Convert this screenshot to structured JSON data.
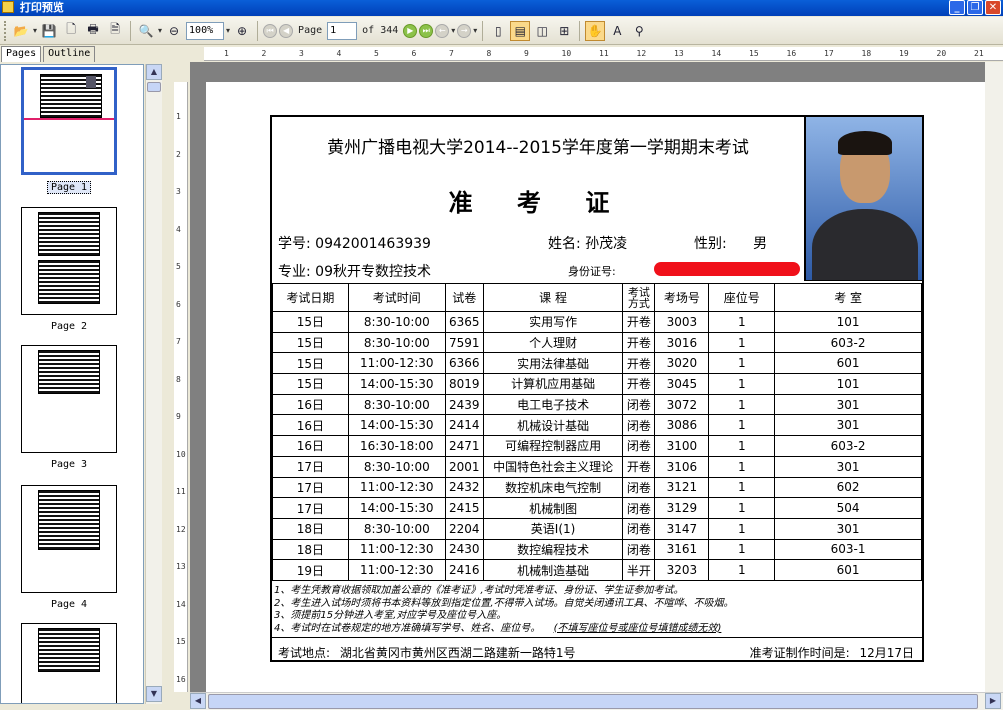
{
  "window": {
    "title": "打印预览"
  },
  "toolbar": {
    "zoom": "100%",
    "page_label": "Page",
    "page_value": "1",
    "of_label": "of 344"
  },
  "left_panel": {
    "tabs": [
      "Pages",
      "Outline"
    ],
    "thumbnails": [
      "Page 1",
      "Page 2",
      "Page 3",
      "Page 4"
    ]
  },
  "ruler": {
    "h_ticks": [
      "1",
      "2",
      "3",
      "4",
      "5",
      "6",
      "7",
      "8",
      "9",
      "10",
      "11",
      "12",
      "13",
      "14",
      "15",
      "16",
      "17",
      "18",
      "19",
      "20",
      "21"
    ],
    "v_ticks": [
      "1",
      "2",
      "3",
      "4",
      "5",
      "6",
      "7",
      "8",
      "9",
      "10",
      "11",
      "12",
      "13",
      "14",
      "15",
      "16"
    ]
  },
  "ticket": {
    "title": "黄州广播电视大学2014--2015学年度第一学期期末考试",
    "heading": "准 考 证",
    "student_id_label": "学号:",
    "student_id": "0942001463939",
    "name_label": "姓名:",
    "name": "孙茂凌",
    "gender_label": "性别:",
    "gender": "男",
    "major_label": "专业:",
    "major": "09秋开专数控技术",
    "id_card_label": "身份证号:",
    "headers": [
      "考试日期",
      "考试时间",
      "试卷",
      "课 程",
      "考试方式",
      "考场号",
      "座位号",
      "考 室"
    ],
    "rows": [
      [
        "15日",
        "8:30-10:00",
        "6365",
        "实用写作",
        "开卷",
        "3003",
        "1",
        "101"
      ],
      [
        "15日",
        "8:30-10:00",
        "7591",
        "个人理财",
        "开卷",
        "3016",
        "1",
        "603-2"
      ],
      [
        "15日",
        "11:00-12:30",
        "6366",
        "实用法律基础",
        "开卷",
        "3020",
        "1",
        "601"
      ],
      [
        "15日",
        "14:00-15:30",
        "8019",
        "计算机应用基础",
        "开卷",
        "3045",
        "1",
        "101"
      ],
      [
        "16日",
        "8:30-10:00",
        "2439",
        "电工电子技术",
        "闭卷",
        "3072",
        "1",
        "301"
      ],
      [
        "16日",
        "14:00-15:30",
        "2414",
        "机械设计基础",
        "闭卷",
        "3086",
        "1",
        "301"
      ],
      [
        "16日",
        "16:30-18:00",
        "2471",
        "可编程控制器应用",
        "闭卷",
        "3100",
        "1",
        "603-2"
      ],
      [
        "17日",
        "8:30-10:00",
        "2001",
        "中国特色社会主义理论",
        "开卷",
        "3106",
        "1",
        "301"
      ],
      [
        "17日",
        "11:00-12:30",
        "2432",
        "数控机床电气控制",
        "闭卷",
        "3121",
        "1",
        "602"
      ],
      [
        "17日",
        "14:00-15:30",
        "2415",
        "机械制图",
        "闭卷",
        "3129",
        "1",
        "504"
      ],
      [
        "18日",
        "8:30-10:00",
        "2204",
        "英语Ⅰ(1)",
        "闭卷",
        "3147",
        "1",
        "301"
      ],
      [
        "18日",
        "11:00-12:30",
        "2430",
        "数控编程技术",
        "闭卷",
        "3161",
        "1",
        "603-1"
      ],
      [
        "19日",
        "11:00-12:30",
        "2416",
        "机械制造基础",
        "半开",
        "3203",
        "1",
        "601"
      ]
    ],
    "notes": [
      "1、考生凭教育收据领取加盖公章的《准考证》,考试时凭准考证、身份证、学生证参加考试。",
      "2、考生进入试场时须将书本资料等放到指定位置,不得带入试场。自觉关闭通讯工具、不喧哗、不吸烟。",
      "3、须提前15分钟进入考室,对应学号及座位号入座。",
      "4、考试时在试卷规定的地方准确填写学号、姓名、座位号。"
    ],
    "note4_extra": "(不填写座位号或座位号填错成绩无效)",
    "location_label": "考试地点:",
    "location": "湖北省黄冈市黄州区西湖二路建新一路特1号",
    "made_time_label": "准考证制作时间是:",
    "made_time": "12月17日"
  }
}
